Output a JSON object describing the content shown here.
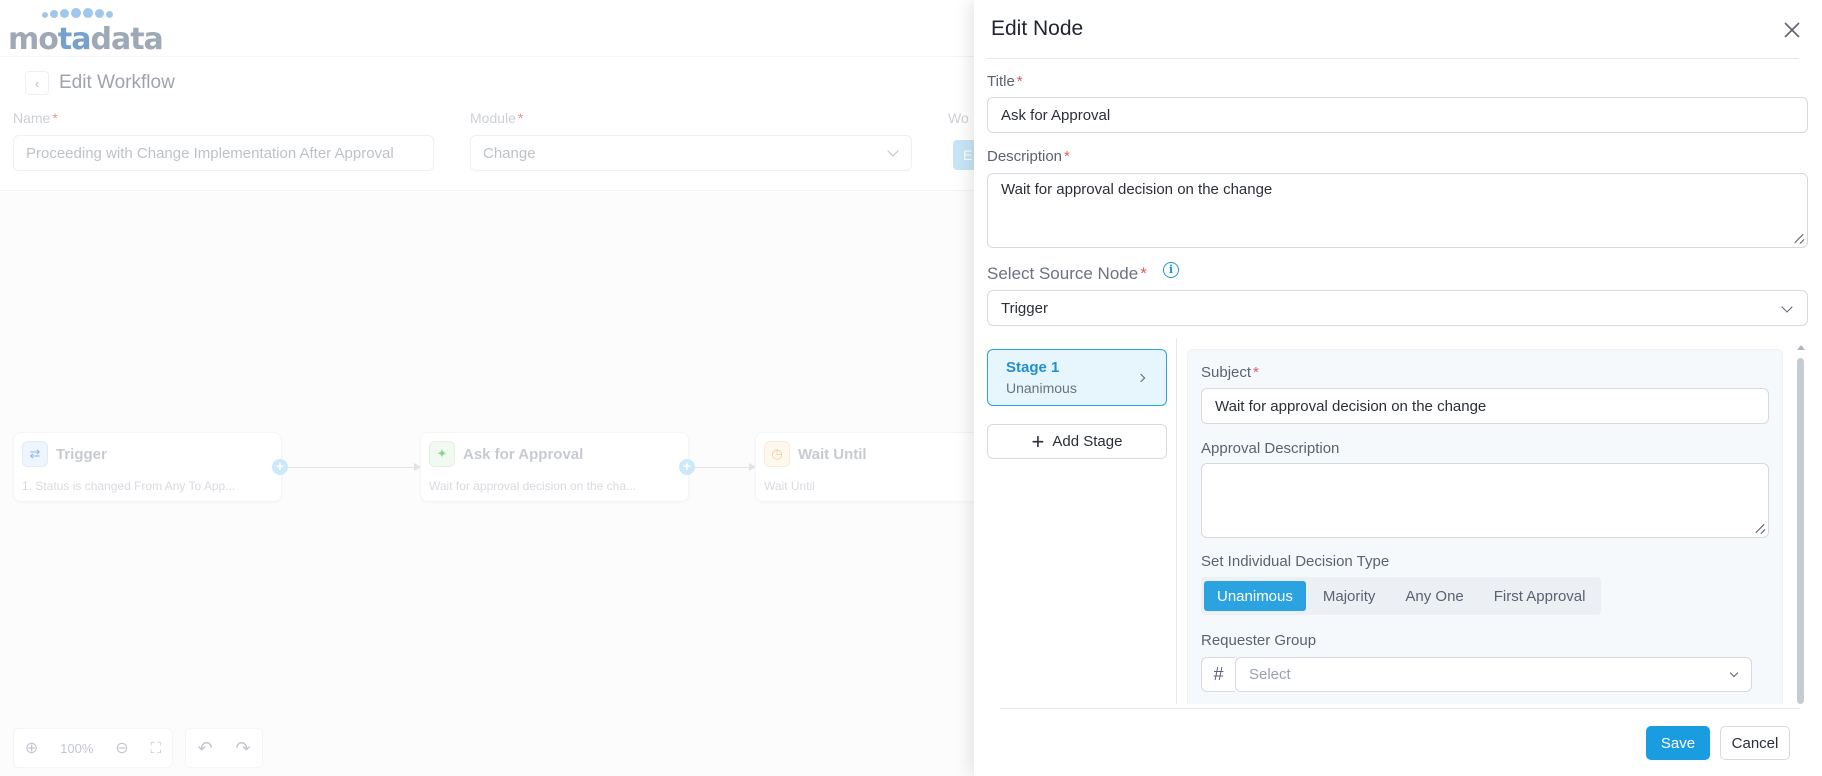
{
  "app": {
    "logo": {
      "prefix": "mo",
      "mid": "ta",
      "suffix": "data"
    }
  },
  "workflow_page": {
    "back_label": "‹",
    "title": "Edit Workflow",
    "fields": {
      "name_label": "Name",
      "name_value": "Proceeding with Change Implementation After Approval",
      "module_label": "Module",
      "module_value": "Change",
      "workflow_label_partial": "Wo",
      "blue_button_partial": "E"
    },
    "nodes": [
      {
        "title": "Trigger",
        "description": "1. Status is changed From Any To App...",
        "icon": "trigger-icon",
        "color": "#4a90d9"
      },
      {
        "title": "Ask for Approval",
        "description": "Wait for approval decision on the cha...",
        "icon": "approval-icon",
        "color": "#5cb85c"
      },
      {
        "title": "Wait Until",
        "description": "Wait Until",
        "icon": "clock-icon",
        "color": "#f0ad4e"
      }
    ],
    "zoom": {
      "level": "100%"
    }
  },
  "drawer": {
    "title": "Edit Node",
    "title_label": "Title",
    "title_value": "Ask for Approval",
    "description_label": "Description",
    "description_value": "Wait for approval decision on the change",
    "source_node_label": "Select Source Node",
    "source_node_value": "Trigger",
    "stages": [
      {
        "name": "Stage 1",
        "type": "Unanimous"
      }
    ],
    "add_stage_label": "Add Stage",
    "stage_form": {
      "subject_label": "Subject",
      "subject_value": "Wait for approval decision on the change",
      "approval_description_label": "Approval Description",
      "approval_description_value": "",
      "decision_type_label": "Set Individual Decision Type",
      "decision_types": [
        "Unanimous",
        "Majority",
        "Any One",
        "First Approval"
      ],
      "decision_type_selected": "Unanimous",
      "requester_group_label": "Requester Group",
      "requester_group_placeholder": "Select"
    },
    "save_label": "Save",
    "cancel_label": "Cancel"
  },
  "colors": {
    "accent": "#1a9de0",
    "required": "#e35b5b",
    "stage_active_bg": "#e7f5fd"
  }
}
